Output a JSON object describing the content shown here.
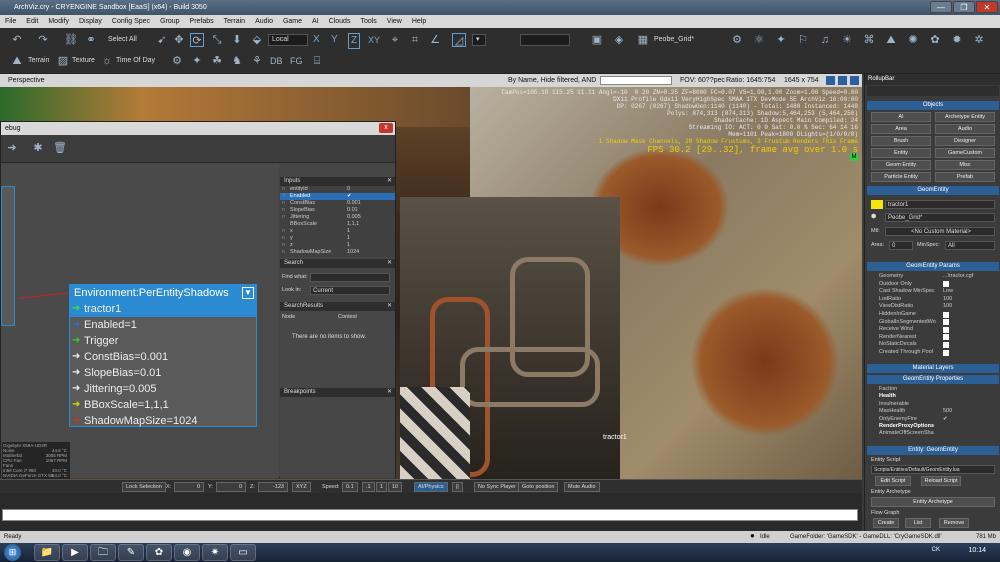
{
  "window": {
    "title": "ArchViz.cry - CRYENGINE Sandbox [EaaS] (x64) - Build 3050",
    "controls": [
      "—",
      "❐",
      "✕"
    ]
  },
  "menu": [
    "File",
    "Edit",
    "Modify",
    "Display",
    "Config Spec",
    "Group",
    "Prefabs",
    "Terrain",
    "Audio",
    "Game",
    "AI",
    "Clouds",
    "Tools",
    "View",
    "Help"
  ],
  "toolbar": {
    "select_all": "Select All",
    "coord_system": "Local",
    "axis_x": "X",
    "axis_y": "Y",
    "axis_z": "Z",
    "axis_xy": "XY",
    "grid_name": "Peobe_Grid*",
    "terrain": "Terrain",
    "texture": "Texture",
    "time_of_day": "Time Of Day",
    "db": "DB",
    "fg": "FG"
  },
  "viewport": {
    "label": "Perspective",
    "filter": "By Name, Hide filtered, AND",
    "fov": "FOV: 60??pec",
    "ratio": "Ratio: 1645:754",
    "size": "1645 x 754",
    "object_label": "tractor1",
    "hud_lines": [
      "CamPos=105.18 115.25 11.11 Angl=-10  0 20 ZN=0.25 ZF=8000 FC=0.07 VS=1,00,1.00 Zoom=1.00 Speed=0.00",
      "DX11 Profile Gdx11 VeryHighSpec SMAA 1TX DevMode SE ArchViz 16:00:00",
      "DP: 0267 (0267) ShadowGen:1140 (1140) - Total: 1480 Instanced: 1448",
      "Polys: 874,313 (874,313) Shadow:5,464,253 (5,464,250)",
      "ShaderCache: 1D Aspect Main Compiled: 24",
      "Streaming IO: ACT: 0 0 Sat: 0.0 % Sec: 64 14 16",
      "Mem=1101 Peak=1800 DLights=(1/0/0/0)",
      "1 Shadow Mask Channels, 20 Shadow Frustums, 3 Frustum Renders This Frame",
      "FPS 30.2 [29..32], frame avg over 1.0 s"
    ]
  },
  "flowgraph": {
    "title_suffix": "ebug",
    "close": "x",
    "node": {
      "title": "Environment:PerEntityShadows",
      "ports": [
        {
          "label": "tractor1",
          "arrow": "➜",
          "color": "#44dd44",
          "selected": true
        },
        {
          "label": "Enabled=1",
          "arrow": "➜",
          "color": "#2a6fd2",
          "selected": false
        },
        {
          "label": "Trigger",
          "arrow": "➜",
          "color": "#33cc33",
          "selected": false
        },
        {
          "label": "ConstBias=0.001",
          "arrow": "➜",
          "color": "#eeeeee",
          "selected": false
        },
        {
          "label": "SlopeBias=0.01",
          "arrow": "➜",
          "color": "#eeeeee",
          "selected": false
        },
        {
          "label": "Jittering=0.005",
          "arrow": "➜",
          "color": "#eeeeee",
          "selected": false
        },
        {
          "label": "BBoxScale=1,1,1",
          "arrow": "➜",
          "color": "#e6d200",
          "selected": false
        },
        {
          "label": "ShadowMapSize=1024",
          "arrow": "➜",
          "color": "#cc3333",
          "selected": false
        }
      ]
    },
    "inputs": {
      "title": "Inputs",
      "rows": [
        {
          "n": "n",
          "k": "entityId",
          "v": "0"
        },
        {
          "n": "?",
          "k": "Enabled",
          "v": "✔",
          "hl": true
        },
        {
          "n": "n",
          "k": "ConstBias",
          "v": "0.001"
        },
        {
          "n": "n",
          "k": "SlopeBias",
          "v": "0.01"
        },
        {
          "n": "n",
          "k": "Jittering",
          "v": "0.005"
        },
        {
          "n": "",
          "k": "BBoxScale",
          "v": "1,1,1"
        },
        {
          "n": "n",
          "k": "x",
          "v": "1"
        },
        {
          "n": "n",
          "k": "y",
          "v": "1"
        },
        {
          "n": "n",
          "k": "z",
          "v": "1"
        },
        {
          "n": "n",
          "k": "ShadowMapSize",
          "v": "1024"
        }
      ]
    },
    "search": {
      "title": "Search",
      "find_label": "Find what:",
      "look_label": "Look in:",
      "look_value": "Current"
    },
    "results": {
      "title": "SearchResults",
      "col_node": "Node",
      "col_context": "Context",
      "empty": "There are no items to show."
    },
    "breakpoints": {
      "title": "Breakpoints"
    }
  },
  "gpu_overlay": {
    "lines": [
      "Gigabyte X58A-UD3R",
      "Noise",
      "Motherbd",
      "CPU Fan",
      "Fans",
      "Intel Core i7 950",
      "NVIDIA GeForce GTX 65",
      "Vdd Toggle Preview 3",
      "Returned"
    ],
    "values": [
      "",
      "44.6 °C",
      "3005 RPM",
      "1067 RPM",
      "",
      "40.0 °C",
      "64.0 °C",
      "",
      ""
    ]
  },
  "rollup": {
    "title": "RollupBar",
    "objects_head": "Objects",
    "object_buttons": [
      "AI",
      "Archetype Entity",
      "Area",
      "Audio",
      "Brush",
      "Designer",
      "Entity",
      "GameCustom",
      "Geom Entity",
      "Misc",
      "Particle Entity",
      "Prefab"
    ],
    "geomentity_head": "GeomEntity",
    "name": "tractor1",
    "material": "Peobe_Grid*",
    "mtl_label": "Mtl:",
    "mtl_value": "<No Custom Material>",
    "area_label": "Area:",
    "area_value": "0",
    "minspec_label": "MinSpec:",
    "minspec_value": "All",
    "params_head": "GeomEntity Params",
    "params": [
      {
        "k": "Geometry",
        "v": "...\\tractor.cgf"
      },
      {
        "k": "Outdoor Only",
        "v": ""
      },
      {
        "k": "Cast Shadow MinSpec",
        "v": "Low"
      },
      {
        "k": "LodRatio",
        "v": "100"
      },
      {
        "k": "ViewDistRatio",
        "v": "100"
      },
      {
        "k": "HiddenInGame",
        "v": ""
      },
      {
        "k": "GlobalInSegmentedWo",
        "v": ""
      },
      {
        "k": "Receive Wind",
        "v": ""
      },
      {
        "k": "RenderNearest",
        "v": ""
      },
      {
        "k": "NoStaticDecals",
        "v": ""
      },
      {
        "k": "Created Through Pool",
        "v": ""
      }
    ],
    "material_layers": "Material Layers",
    "props_head": "GeomEntity Properties",
    "props": [
      {
        "k": "Faction",
        "v": ""
      },
      {
        "k": "Health",
        "v": ""
      },
      {
        "k": "Invulnerable",
        "v": ""
      },
      {
        "k": "MaxHealth",
        "v": "500"
      },
      {
        "k": "OnlyEnemyFire",
        "v": "✔"
      },
      {
        "k": "RenderProxyOptions",
        "v": ""
      },
      {
        "k": "AnimateOffScreenSha",
        "v": ""
      }
    ],
    "entity_head": "Entity: GeomEntity",
    "entity_script_label": "Entity Script",
    "entity_script": "Scripts/Entities/Default/GeomEntity.lua",
    "edit_script": "Edit Script",
    "reload_script": "Reload Script",
    "archetype_label": "Entity Archetype",
    "archetype_btn": "Entity Archetype",
    "flowgraph_label": "Flow Graph",
    "create": "Create",
    "list": "List",
    "remove": "Remove"
  },
  "statusbar": {
    "lock": "Lock Selection",
    "x_label": "X:",
    "x_value": "0",
    "y_label": "Y:",
    "y_value": "0",
    "z_label": "Z:",
    "z_value": "-123",
    "xyz": "XYZ",
    "speed_label": "Speed:",
    "speed_value": "0.1",
    "speed_a": ".1",
    "speed_b": "1",
    "speed_c": "10",
    "ai_physics": "AI/Physics",
    "no_sync": "No Sync Player",
    "goto": "Goto position",
    "mute": "Mute Audio"
  },
  "readybar": {
    "ready": "Ready",
    "idle": "Idle",
    "folders": "GameFolder: 'GameSDK' - GameDLL: 'CryGameSDK.dll'",
    "mem": "781 Mb"
  },
  "taskbar": {
    "clock": "10:14",
    "lang": "CK"
  }
}
